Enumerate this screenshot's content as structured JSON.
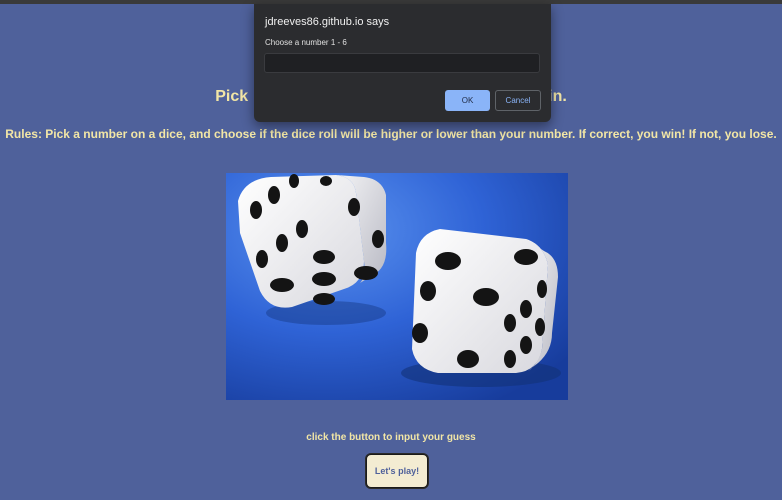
{
  "page": {
    "heading": "Pick a number, higher or lower, to win.",
    "heading_visible_left": "Pick",
    "heading_visible_right": "in.",
    "rules": "Rules: Pick a number on a dice, and choose if the dice roll will be higher or lower than your number. If correct, you win! If not, you lose.",
    "prompt_text": "click the button to input your guess",
    "play_button_label": "Let's play!"
  },
  "dialog": {
    "title": "jdreeves86.github.io says",
    "message": "Choose a number 1 - 6",
    "input_value": "",
    "ok_label": "OK",
    "cancel_label": "Cancel"
  },
  "colors": {
    "page_background": "#4f619b",
    "text_accent": "#f2e6a6",
    "dialog_background": "#2b2c2f",
    "dialog_primary": "#8ab4f8",
    "dice_backdrop": "#2f63d6"
  }
}
